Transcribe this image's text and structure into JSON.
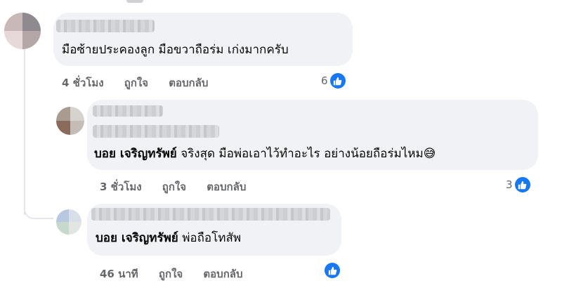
{
  "comments": [
    {
      "text": "มือซ้ายประคองลูก มือขวาถือร่ม เก่งมากครับ",
      "time": "4 ชั่วโมง",
      "like_label": "ถูกใจ",
      "reply_label": "ตอบกลับ",
      "reaction_count": "6"
    },
    {
      "mention": "บอย เจริญทรัพย์",
      "text": "จริงสุด มือพ่อเอาไว้ทำอะไร อย่างน้อยถือร่มไหม😅",
      "time": "3 ชั่วโมง",
      "like_label": "ถูกใจ",
      "reply_label": "ตอบกลับ",
      "reaction_count": "3"
    },
    {
      "mention": "บอย เจริญทรัพย์",
      "text": "พ่อถือโทสัพ",
      "time": "46 นาที",
      "like_label": "ถูกใจ",
      "reply_label": "ตอบกลับ"
    }
  ],
  "colors": {
    "bubble": "#f0f2f5",
    "meta_text": "#65676b",
    "like_blue": "#1877f2"
  },
  "icons": [
    "thumbs-up-icon",
    "avatar-pixelated"
  ]
}
